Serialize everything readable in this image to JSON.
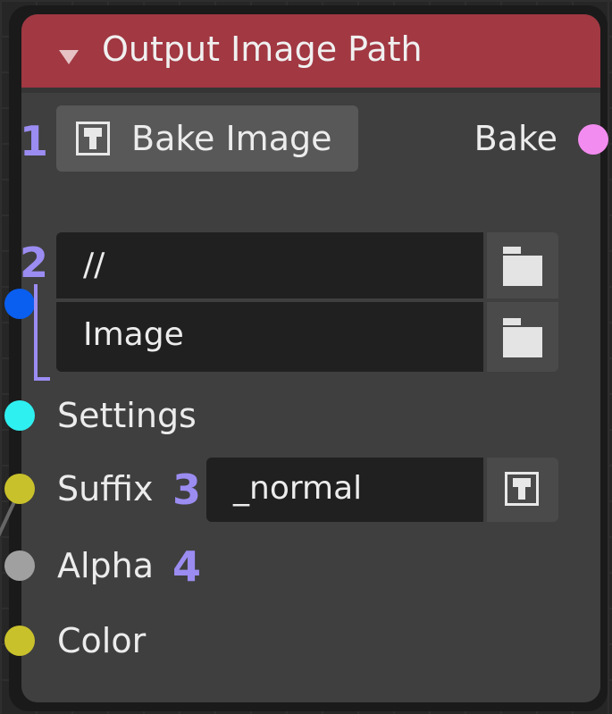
{
  "node": {
    "title": "Output Image Path",
    "bake_button_label": "Bake Image",
    "output_label": "Bake",
    "path_directory": "//",
    "path_filename": "Image",
    "inputs": {
      "settings": "Settings",
      "suffix": "Suffix",
      "suffix_value": "_normal",
      "alpha": "Alpha",
      "color": "Color"
    }
  },
  "annotations": {
    "marker_1": "1",
    "marker_2": "2",
    "marker_3": "3",
    "marker_4": "4"
  },
  "icons": {
    "bake": "image-icon",
    "dir_browse": "folder-icon",
    "file_browse": "folder-icon",
    "suffix_action": "image-icon"
  },
  "colors": {
    "header": "#a13842",
    "socket_bake": "#f38cf0",
    "socket_path": "#0a5ef0",
    "socket_settings": "#2ff0f0",
    "socket_suffix": "#c9c12b",
    "socket_alpha": "#a0a0a0",
    "socket_color": "#c9c12b",
    "annotation": "#9b8cf2"
  }
}
